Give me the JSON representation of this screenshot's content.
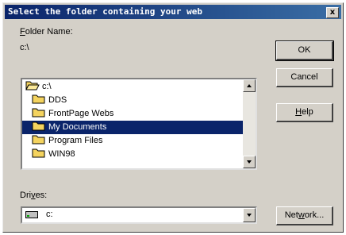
{
  "dialog": {
    "title": "Select the folder containing your web",
    "close_glyph": "x"
  },
  "folder_name": {
    "label_accel": "F",
    "label_rest": "older Name:",
    "value": "c:\\"
  },
  "folder_list": {
    "items": [
      {
        "label": "c:\\",
        "icon": "open-folder-icon",
        "selected": false
      },
      {
        "label": "DDS",
        "icon": "folder-icon",
        "selected": false
      },
      {
        "label": "FrontPage Webs",
        "icon": "folder-icon",
        "selected": false
      },
      {
        "label": "My Documents",
        "icon": "folder-icon",
        "selected": true
      },
      {
        "label": "Program Files",
        "icon": "folder-icon",
        "selected": false
      },
      {
        "label": "WIN98",
        "icon": "folder-icon",
        "selected": false
      }
    ]
  },
  "drives": {
    "label_pre": "Dri",
    "label_accel": "v",
    "label_rest": "es:",
    "value": "c:"
  },
  "buttons": {
    "ok": "OK",
    "cancel": "Cancel",
    "help_accel": "H",
    "help_rest": "elp",
    "network_pre": "Net",
    "network_accel": "w",
    "network_rest": "ork..."
  },
  "colors": {
    "selection": "#0a246a",
    "face": "#d4d0c8",
    "folder": "#f4d35e"
  }
}
